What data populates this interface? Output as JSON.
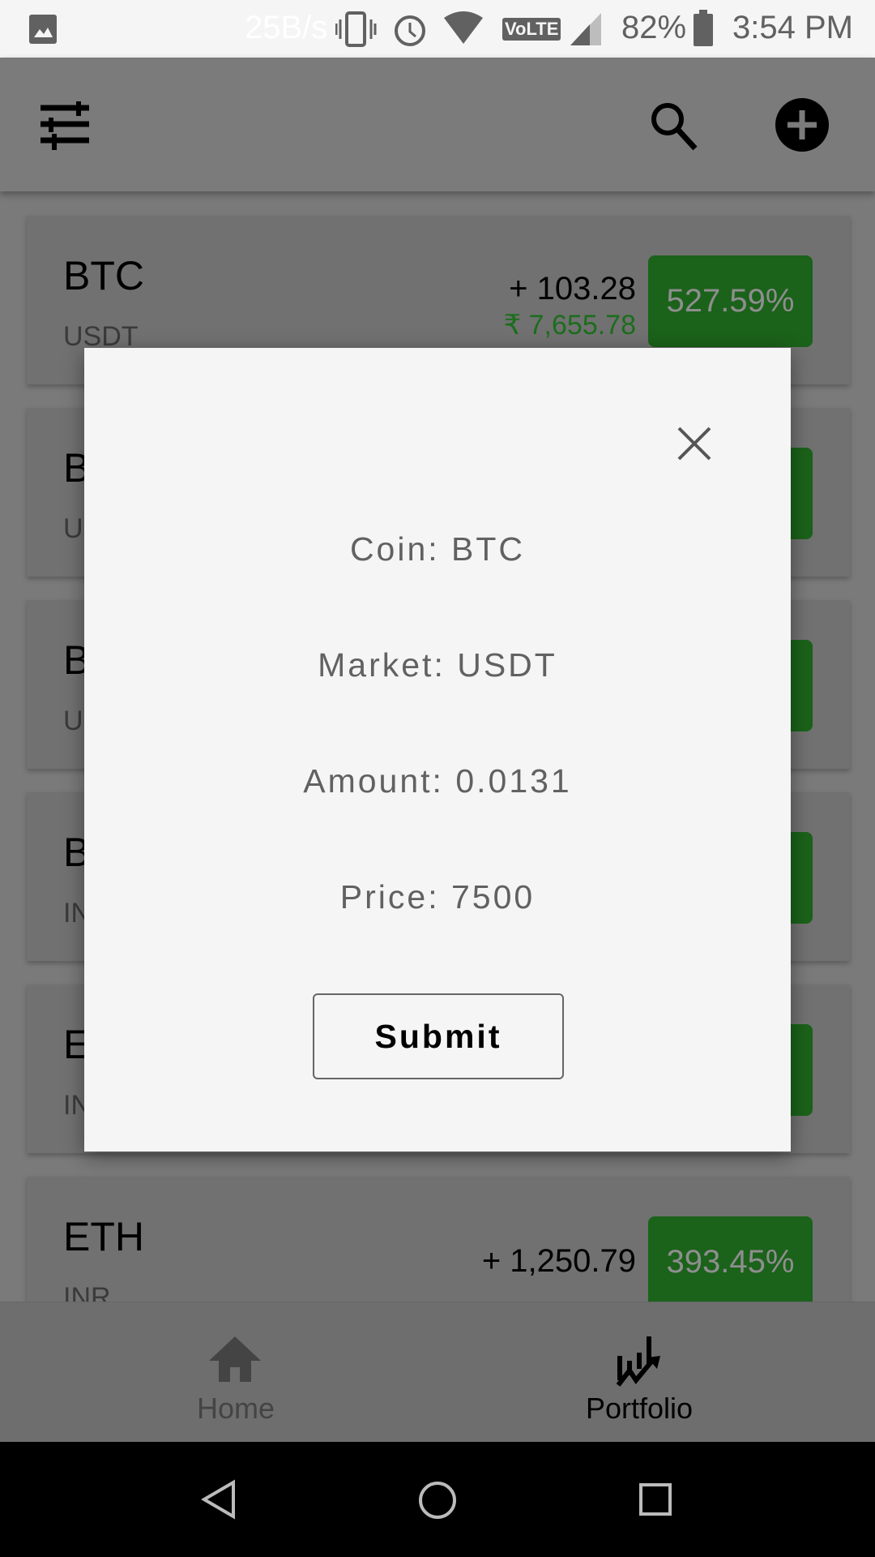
{
  "status_bar": {
    "net_speed": "25B/s",
    "network": "VoLTE",
    "battery": "82%",
    "time": "3:54 PM",
    "icons": [
      "gallery-icon",
      "vibrate-icon",
      "alarm-icon",
      "wifi-icon",
      "signal-icon",
      "battery-icon"
    ]
  },
  "app_bar": {
    "icons": [
      "filter-icon",
      "search-icon",
      "add-circle-icon"
    ]
  },
  "cards": [
    {
      "symbol": "BTC",
      "market": "USDT",
      "change": "+ 103.28",
      "inr": "₹ 7,655.78",
      "percent": "527.59%"
    },
    {
      "symbol": "B",
      "market": "US"
    },
    {
      "symbol": "B",
      "market": "US"
    },
    {
      "symbol": "B",
      "market": "IN"
    },
    {
      "symbol": "E",
      "market": "IN"
    },
    {
      "symbol": "ETH",
      "market": "INR",
      "change": "+ 1,250.79",
      "percent": "393.45%"
    }
  ],
  "dialog": {
    "coin": "Coin: BTC",
    "market": "Market: USDT",
    "amount": "Amount: 0.0131",
    "price": "Price: 7500",
    "submit": "Submit"
  },
  "bottom_nav": {
    "home": "Home",
    "portfolio": "Portfolio"
  },
  "colors": {
    "badge": "#1b621a",
    "inr": "#1d6d1d"
  }
}
